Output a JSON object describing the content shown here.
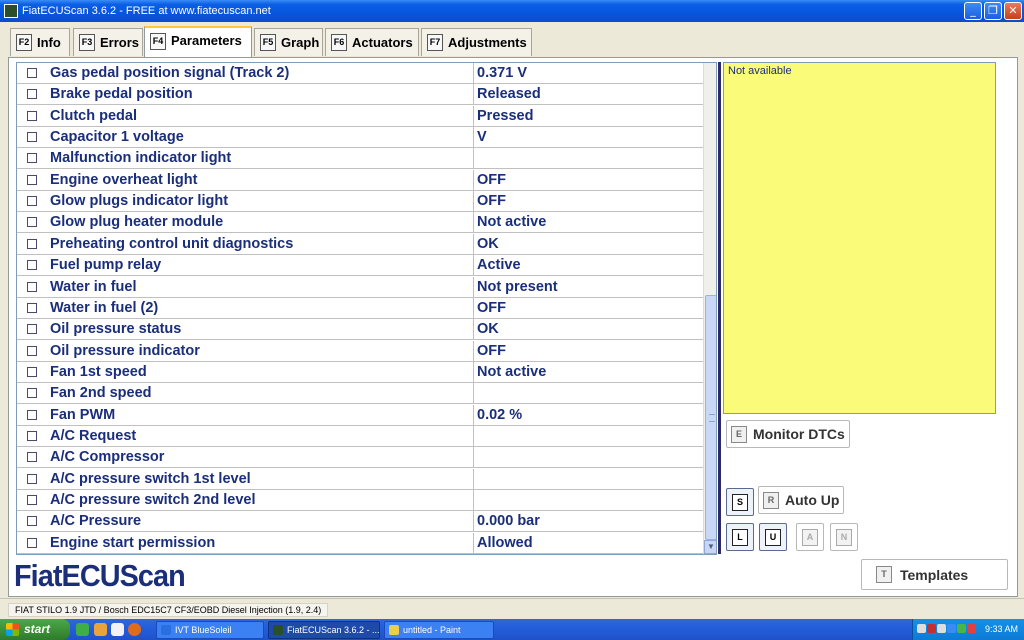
{
  "window": {
    "title": "FiatECUScan 3.6.2 - FREE at www.fiatecuscan.net",
    "minimize": "_",
    "maximize": "❐",
    "close": "✕"
  },
  "tabs": [
    {
      "key": "F2",
      "label": "Info",
      "active": false
    },
    {
      "key": "F3",
      "label": "Errors",
      "active": false
    },
    {
      "key": "F4",
      "label": "Parameters",
      "active": true
    },
    {
      "key": "F5",
      "label": "Graph",
      "active": false
    },
    {
      "key": "F6",
      "label": "Actuators",
      "active": false
    },
    {
      "key": "F7",
      "label": "Adjustments",
      "active": false
    }
  ],
  "parameters": [
    {
      "name": "Gas pedal position signal (Track 2)",
      "value": "0.371 V"
    },
    {
      "name": "Brake pedal position",
      "value": "Released"
    },
    {
      "name": "Clutch pedal",
      "value": "Pressed"
    },
    {
      "name": "Capacitor 1 voltage",
      "value": " V"
    },
    {
      "name": "Malfunction indicator light",
      "value": ""
    },
    {
      "name": "Engine overheat light",
      "value": "OFF"
    },
    {
      "name": "Glow plugs indicator light",
      "value": "OFF"
    },
    {
      "name": "Glow plug heater module",
      "value": "Not active"
    },
    {
      "name": "Preheating control unit diagnostics",
      "value": "OK"
    },
    {
      "name": "Fuel pump relay",
      "value": "Active"
    },
    {
      "name": "Water in fuel",
      "value": "Not present"
    },
    {
      "name": "Water in fuel (2)",
      "value": "OFF"
    },
    {
      "name": "Oil pressure status",
      "value": "OK"
    },
    {
      "name": "Oil pressure indicator",
      "value": "OFF"
    },
    {
      "name": "Fan 1st speed",
      "value": "Not active"
    },
    {
      "name": "Fan 2nd speed",
      "value": ""
    },
    {
      "name": "Fan PWM",
      "value": "0.02 %"
    },
    {
      "name": "A/C Request",
      "value": ""
    },
    {
      "name": "A/C Compressor",
      "value": ""
    },
    {
      "name": "A/C pressure switch 1st level",
      "value": ""
    },
    {
      "name": "A/C pressure switch 2nd level",
      "value": ""
    },
    {
      "name": "A/C Pressure",
      "value": "0.000 bar"
    },
    {
      "name": "Engine start permission",
      "value": "Allowed"
    }
  ],
  "info_panel": {
    "text": "Not available",
    "color": "#fbfb7a"
  },
  "buttons": {
    "monitor_dtcs": {
      "key": "E",
      "label": "Monitor DTCs"
    },
    "auto_up": {
      "key": "R",
      "label": "Auto Up"
    },
    "s": {
      "key": "S"
    },
    "l": {
      "key": "L"
    },
    "u": {
      "key": "U"
    },
    "a": {
      "key": "A"
    },
    "n": {
      "key": "N"
    },
    "templates": {
      "key": "T",
      "label": "Templates"
    }
  },
  "logo": "FiatECUScan",
  "status_bar": "FIAT STILO 1.9 JTD / Bosch EDC15C7 CF3/EOBD Diesel Injection (1.9, 2.4)",
  "taskbar": {
    "start": "start",
    "tasks": [
      {
        "label": "IVT BlueSoleil",
        "active": false
      },
      {
        "label": "FiatECUScan 3.6.2 - ...",
        "active": true
      },
      {
        "label": "untitled - Paint",
        "active": false
      }
    ],
    "clock": "9:33 AM"
  },
  "colors": {
    "accent": "#1a2e7a",
    "info_yellow": "#fbfb7a",
    "titlebar": "#0855dd"
  }
}
